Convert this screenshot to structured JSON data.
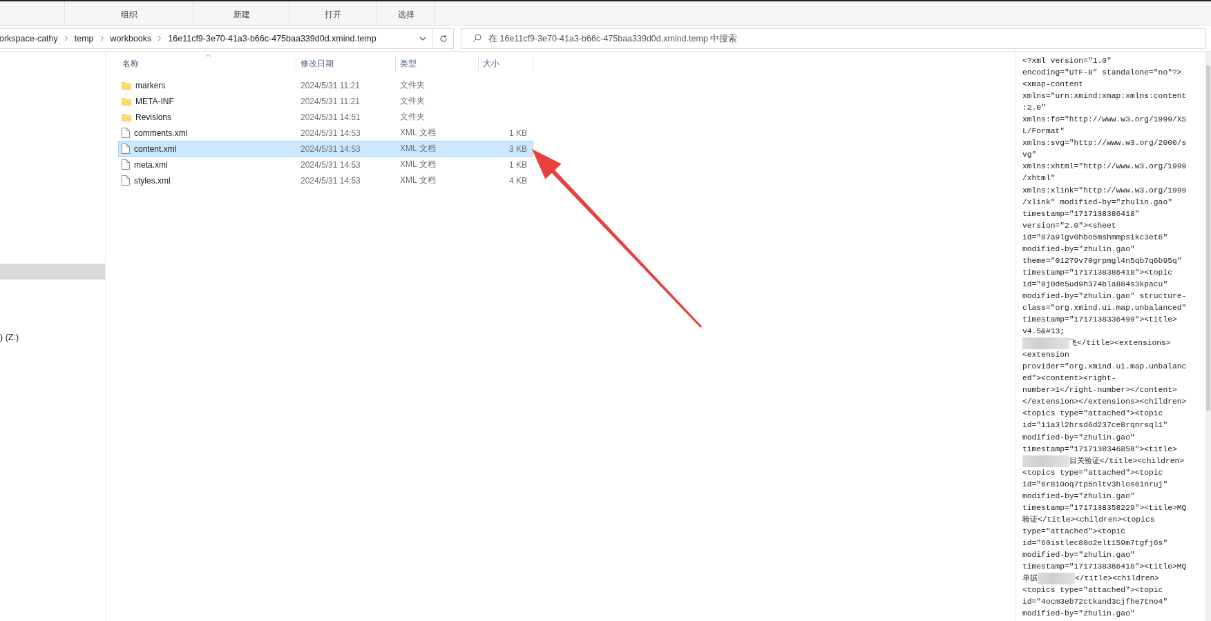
{
  "ribbon": {
    "groups": [
      "组织",
      "新建",
      "打开",
      "选择"
    ]
  },
  "address_bar": {
    "breadcrumb": [
      "orkspace-cathy",
      "temp",
      "workbooks",
      "16e11cf9-3e70-41a3-b66c-475baa339d0d.xmind.temp"
    ]
  },
  "search": {
    "placeholder": "在 16e11cf9-3e70-41a3-b66c-475baa339d0d.xmind.temp 中搜索"
  },
  "sidebar": {
    "items": [
      {
        "kind": "blank",
        "selected": true
      },
      {
        "kind": "drive",
        "label": ") (Z:)",
        "selected": false
      }
    ]
  },
  "file_list": {
    "columns": [
      {
        "label": "名称",
        "sorted": true
      },
      {
        "label": "修改日期",
        "sorted": false
      },
      {
        "label": "类型",
        "sorted": false
      },
      {
        "label": "大小",
        "sorted": false
      }
    ],
    "rows": [
      {
        "kind": "folder",
        "name": "markers",
        "date": "2024/5/31 11:21",
        "type": "文件夹",
        "selected": false
      },
      {
        "kind": "folder",
        "name": "META-INF",
        "date": "2024/5/31 11:21",
        "type": "文件夹",
        "selected": false
      },
      {
        "kind": "folder",
        "name": "Revisions",
        "date": "2024/5/31 14:51",
        "type": "文件夹",
        "selected": false
      },
      {
        "kind": "file",
        "name": "comments.xml",
        "date": "2024/5/31 14:53",
        "type": "XML 文档",
        "size": "1 KB",
        "selected": false
      },
      {
        "kind": "file",
        "name": "content.xml",
        "date": "2024/5/31 14:53",
        "type": "XML 文档",
        "size": "3 KB",
        "selected": true
      },
      {
        "kind": "file",
        "name": "meta.xml",
        "date": "2024/5/31 14:53",
        "type": "XML 文档",
        "size": "1 KB",
        "selected": false
      },
      {
        "kind": "file",
        "name": "styles.xml",
        "date": "2024/5/31 14:53",
        "type": "XML 文档",
        "size": "4 KB",
        "selected": false
      }
    ]
  },
  "preview": {
    "lines": [
      {
        "kind": "plain",
        "text": "<?xml version=\"1.0\""
      },
      {
        "kind": "plain",
        "text": "encoding=\"UTF-8\" standalone=\"no\"?>"
      },
      {
        "kind": "plain",
        "text": "<xmap-content"
      },
      {
        "kind": "plain",
        "text": "xmlns=\"urn:xmind:xmap:xmlns:content"
      },
      {
        "kind": "plain",
        "text": ":2.0\""
      },
      {
        "kind": "plain",
        "text": "xmlns:fo=\"http://www.w3.org/1999/XS"
      },
      {
        "kind": "plain",
        "text": "L/Format\""
      },
      {
        "kind": "plain",
        "text": "xmlns:svg=\"http://www.w3.org/2000/s"
      },
      {
        "kind": "plain",
        "text": "vg\""
      },
      {
        "kind": "plain",
        "text": "xmlns:xhtml=\"http://www.w3.org/1999"
      },
      {
        "kind": "plain",
        "text": "/xhtml\""
      },
      {
        "kind": "plain",
        "text": "xmlns:xlink=\"http://www.w3.org/1999"
      },
      {
        "kind": "plain",
        "text": "/xlink\" modified-by=\"zhulin.gao\""
      },
      {
        "kind": "plain",
        "text": "timestamp=\"1717138386418\""
      },
      {
        "kind": "plain",
        "text": "version=\"2.0\"><sheet"
      },
      {
        "kind": "plain",
        "text": "id=\"07a9lgv0hbo5mshmmpsikc3et6\""
      },
      {
        "kind": "plain",
        "text": "modified-by=\"zhulin.gao\""
      },
      {
        "kind": "plain",
        "text": "theme=\"01279v70grpmgl4n5qb7q6b95q\""
      },
      {
        "kind": "plain",
        "text": "timestamp=\"1717138386418\"><topic"
      },
      {
        "kind": "plain",
        "text": "id=\"0j0de5ud9h374bla884s3kpacu\""
      },
      {
        "kind": "plain",
        "text": "modified-by=\"zhulin.gao\" structure-"
      },
      {
        "kind": "plain",
        "text": "class=\"org.xmind.ui.map.unbalanced\""
      },
      {
        "kind": "plain",
        "text": "timestamp=\"1717138336499\"><title>"
      },
      {
        "kind": "plain",
        "text": "v4.5&#13;"
      },
      {
        "kind": "lead_redacted",
        "text": "飞</title><extensions>"
      },
      {
        "kind": "plain",
        "text": "<extension"
      },
      {
        "kind": "plain",
        "text": "provider=\"org.xmind.ui.map.unbalanc"
      },
      {
        "kind": "plain",
        "text": "ed\"><content><right-"
      },
      {
        "kind": "plain",
        "text": "number>1</right-number></content>"
      },
      {
        "kind": "plain",
        "text": "</extension></extensions><children>"
      },
      {
        "kind": "plain",
        "text": "<topics type=\"attached\"><topic"
      },
      {
        "kind": "plain",
        "text": "id=\"11a3l2hrsd6d237ce8rqnrsql1\""
      },
      {
        "kind": "plain",
        "text": "modified-by=\"zhulin.gao\""
      },
      {
        "kind": "plain",
        "text": "timestamp=\"1717138346858\"><title>"
      },
      {
        "kind": "lead_redacted",
        "text": "目关验证</title><children>"
      },
      {
        "kind": "plain",
        "text": "<topics type=\"attached\"><topic"
      },
      {
        "kind": "plain",
        "text": "id=\"6r8i0oq7tp5nltv3hlos61nruj\""
      },
      {
        "kind": "plain",
        "text": "modified-by=\"zhulin.gao\""
      },
      {
        "kind": "plain",
        "text": "timestamp=\"1717138358229\"><title>MQ"
      },
      {
        "kind": "plain",
        "text": "验证</title><children><topics"
      },
      {
        "kind": "plain",
        "text": "type=\"attached\"><topic"
      },
      {
        "kind": "plain",
        "text": "id=\"60istlec80o2elt159m7tgfj6s\""
      },
      {
        "kind": "plain",
        "text": "modified-by=\"zhulin.gao\""
      },
      {
        "kind": "plain",
        "text": "timestamp=\"1717138386418\"><title>MQ"
      },
      {
        "kind": "mid_redacted",
        "text": "单据",
        "rest": "</title><children>"
      },
      {
        "kind": "plain",
        "text": "<topics type=\"attached\"><topic"
      },
      {
        "kind": "plain",
        "text": "id=\"4ocm3eb72ctkand3cjfhe7tno4\""
      },
      {
        "kind": "plain",
        "text": "modified-by=\"zhulin.gao\""
      }
    ]
  }
}
